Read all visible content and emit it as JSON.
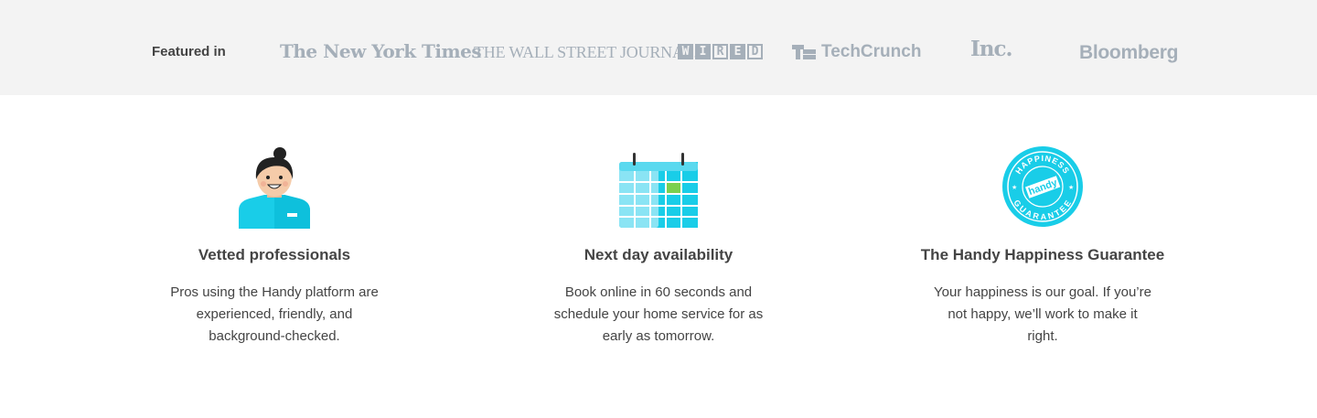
{
  "press": {
    "label": "Featured in",
    "logos": {
      "nyt": "The New York Times",
      "wsj": "THE WALL STREET JOURNAL.",
      "wired": [
        "W",
        "I",
        "R",
        "E",
        "D"
      ],
      "techcrunch": "TechCrunch",
      "inc": "Inc.",
      "bloomberg": "Bloomberg"
    },
    "logo_color": "#a5afb9"
  },
  "features": [
    {
      "icon": "professional-avatar-icon",
      "title": "Vetted professionals",
      "text": "Pros using the Handy platform are experienced, friendly, and background-checked."
    },
    {
      "icon": "calendar-icon",
      "title": "Next day availability",
      "text": "Book online in 60 seconds and schedule your home service for as early as tomorrow."
    },
    {
      "icon": "guarantee-seal-icon",
      "title": "The Handy Happiness Guarantee",
      "text": "Your happiness is our goal. If you’re not happy, we’ll work to make it right.",
      "seal": {
        "top": "HAPPINESS",
        "center": "handy",
        "bottom": "GUARANTEE"
      }
    }
  ],
  "colors": {
    "accent": "#0ed4ef",
    "calendar_highlight": "#7bd04f"
  }
}
